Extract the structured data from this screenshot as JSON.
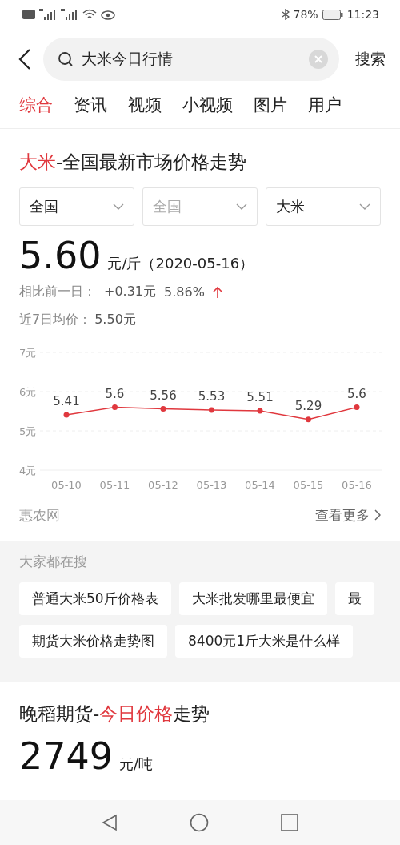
{
  "status_bar": {
    "battery": "78%",
    "time": "11:23"
  },
  "search": {
    "value": "大米今日行情",
    "button": "搜索"
  },
  "tabs": [
    {
      "label": "综合",
      "selected": true
    },
    {
      "label": "资讯",
      "selected": false
    },
    {
      "label": "视频",
      "selected": false
    },
    {
      "label": "小视频",
      "selected": false
    },
    {
      "label": "图片",
      "selected": false
    },
    {
      "label": "用户",
      "selected": false
    }
  ],
  "price_card": {
    "title": [
      {
        "text": "大米",
        "highlight": true
      },
      {
        "text": "-全国最新市场价格走势",
        "highlight": false
      }
    ],
    "dropdowns": [
      {
        "value": "全国",
        "disabled": false
      },
      {
        "value": "全国",
        "disabled": true
      },
      {
        "value": "大米",
        "disabled": false
      }
    ],
    "price": "5.60",
    "unit": "元/斤（2020-05-16）",
    "change": {
      "label": "相比前一日：",
      "amount": "+0.31元",
      "percent": "5.86%",
      "rising": true
    },
    "average": {
      "label": "近7日均价：",
      "value": "5.50元"
    },
    "chart_data": {
      "type": "line",
      "categories": [
        "05-10",
        "05-11",
        "05-12",
        "05-13",
        "05-14",
        "05-15",
        "05-16"
      ],
      "series": [
        {
          "color": "#e0383e",
          "marker": true,
          "values": [
            5.41,
            5.6,
            5.56,
            5.53,
            5.51,
            5.29,
            5.6
          ]
        }
      ],
      "ylim": [
        4,
        7
      ],
      "yticks": [
        {
          "value": 4,
          "label": "4元"
        },
        {
          "value": 5,
          "label": "5元"
        },
        {
          "value": 6,
          "label": "6元"
        },
        {
          "value": 7,
          "label": "7元"
        }
      ],
      "data_labels": true
    },
    "source": "惠农网",
    "more": "查看更多"
  },
  "popular": {
    "title": "大家都在搜",
    "rows": [
      [
        "普通大米50斤价格表",
        "大米批发哪里最便宜",
        "最"
      ],
      [
        "期货大米价格走势图",
        "8400元1斤大米是什么样"
      ]
    ]
  },
  "futures_card": {
    "title": [
      {
        "text": "晚稻期货-",
        "highlight": false
      },
      {
        "text": "今日价格",
        "highlight": true
      },
      {
        "text": "走势",
        "highlight": false
      }
    ],
    "price": "2749",
    "unit": "元/吨"
  }
}
